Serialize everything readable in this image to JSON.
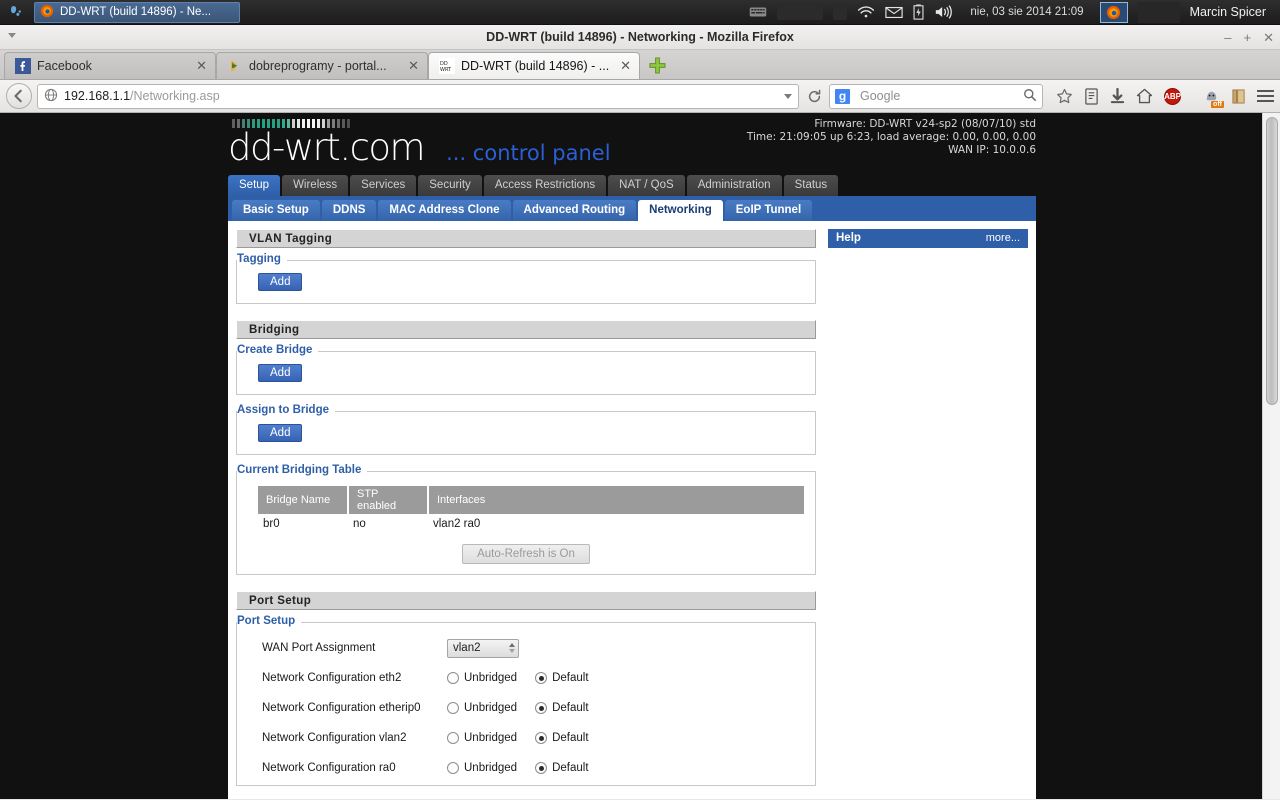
{
  "taskbar": {
    "launcher_icon": "gnome-foot-icon",
    "window_button": {
      "title": "DD-WRT (build 14896) - Ne...",
      "icon": "firefox-icon"
    },
    "tray": {
      "keyboard_icon": "keyboard-icon",
      "wifi_icon": "wifi-icon",
      "mail_icon": "mail-icon",
      "battery_icon": "battery-icon",
      "volume_icon": "volume-icon",
      "clock": "nie, 03 sie 2014 21:09",
      "active_app_icon": "firefox-icon",
      "user": "Marcin Spicer"
    }
  },
  "browser": {
    "window_title": "DD-WRT (build 14896) - Networking - Mozilla Firefox",
    "window_controls": {
      "minimize": "–",
      "maximize": "+",
      "close": "✕"
    },
    "tabs": [
      {
        "label": "Facebook",
        "icon": "facebook-icon",
        "active": false
      },
      {
        "label": "dobreprogramy - portal...",
        "icon": "dobreprogramy-icon",
        "active": false
      },
      {
        "label": "DD-WRT (build 14896) - ...",
        "icon": "ddwrt-icon",
        "active": true
      }
    ],
    "new_tab_label": "+",
    "url": {
      "host": "192.168.1.1",
      "path": "/Networking.asp"
    },
    "search": {
      "engine": "Google",
      "engine_badge": "g",
      "placeholder": "Google"
    },
    "toolbar_icons": [
      "back-icon",
      "reload-icon",
      "search-icon",
      "bookmark-star-icon",
      "reading-list-icon",
      "downloads-icon",
      "home-icon",
      "adblock-plus-icon",
      "noscript-icon",
      "bookmarks-library-icon",
      "menu-hamburger-icon"
    ],
    "adblock_badge": "ABP",
    "noscript_badge": "off"
  },
  "ddwrt": {
    "logo": {
      "name": "dd-wrt",
      "suffix": ".com",
      "tagline": "... control panel"
    },
    "info": {
      "firmware": "Firmware: DD-WRT v24-sp2 (08/07/10) std",
      "time": "Time: 21:09:05 up 6:23, load average: 0.00, 0.00, 0.00",
      "wan_ip": "WAN IP: 10.0.0.6"
    },
    "main_tabs": [
      {
        "label": "Setup",
        "selected": true
      },
      {
        "label": "Wireless",
        "selected": false
      },
      {
        "label": "Services",
        "selected": false
      },
      {
        "label": "Security",
        "selected": false
      },
      {
        "label": "Access Restrictions",
        "selected": false
      },
      {
        "label": "NAT / QoS",
        "selected": false
      },
      {
        "label": "Administration",
        "selected": false
      },
      {
        "label": "Status",
        "selected": false
      }
    ],
    "sub_tabs": [
      {
        "label": "Basic Setup",
        "selected": false
      },
      {
        "label": "DDNS",
        "selected": false
      },
      {
        "label": "MAC Address Clone",
        "selected": false
      },
      {
        "label": "Advanced Routing",
        "selected": false
      },
      {
        "label": "Networking",
        "selected": true
      },
      {
        "label": "EoIP Tunnel",
        "selected": false
      }
    ],
    "help": {
      "title": "Help",
      "more": "more..."
    },
    "sections": {
      "vlan_tagging": {
        "heading": "VLAN Tagging",
        "tagging": {
          "legend": "Tagging",
          "add_label": "Add"
        }
      },
      "bridging": {
        "heading": "Bridging",
        "create_bridge": {
          "legend": "Create Bridge",
          "add_label": "Add"
        },
        "assign_to_bridge": {
          "legend": "Assign to Bridge",
          "add_label": "Add"
        },
        "current_table": {
          "legend": "Current Bridging Table",
          "columns": [
            "Bridge Name",
            "STP enabled",
            "Interfaces"
          ],
          "rows": [
            [
              "br0",
              "no",
              "vlan2 ra0"
            ]
          ],
          "refresh_label": "Auto-Refresh is On"
        }
      },
      "port_setup": {
        "heading": "Port Setup",
        "legend": "Port Setup",
        "wan_port": {
          "label": "WAN Port Assignment",
          "value": "vlan2"
        },
        "net_configs": [
          {
            "label": "Network Configuration eth2",
            "unbridged_label": "Unbridged",
            "default_label": "Default",
            "selected": "Default"
          },
          {
            "label": "Network Configuration etherip0",
            "unbridged_label": "Unbridged",
            "default_label": "Default",
            "selected": "Default"
          },
          {
            "label": "Network Configuration vlan2",
            "unbridged_label": "Unbridged",
            "default_label": "Default",
            "selected": "Default"
          },
          {
            "label": "Network Configuration ra0",
            "unbridged_label": "Unbridged",
            "default_label": "Default",
            "selected": "Default"
          }
        ]
      }
    },
    "colors": {
      "accent_blue": "#2f5fa8",
      "logo_teal": "#3fa38d",
      "tagline_blue": "#2a5fd6",
      "page_bg": "#111111"
    }
  }
}
